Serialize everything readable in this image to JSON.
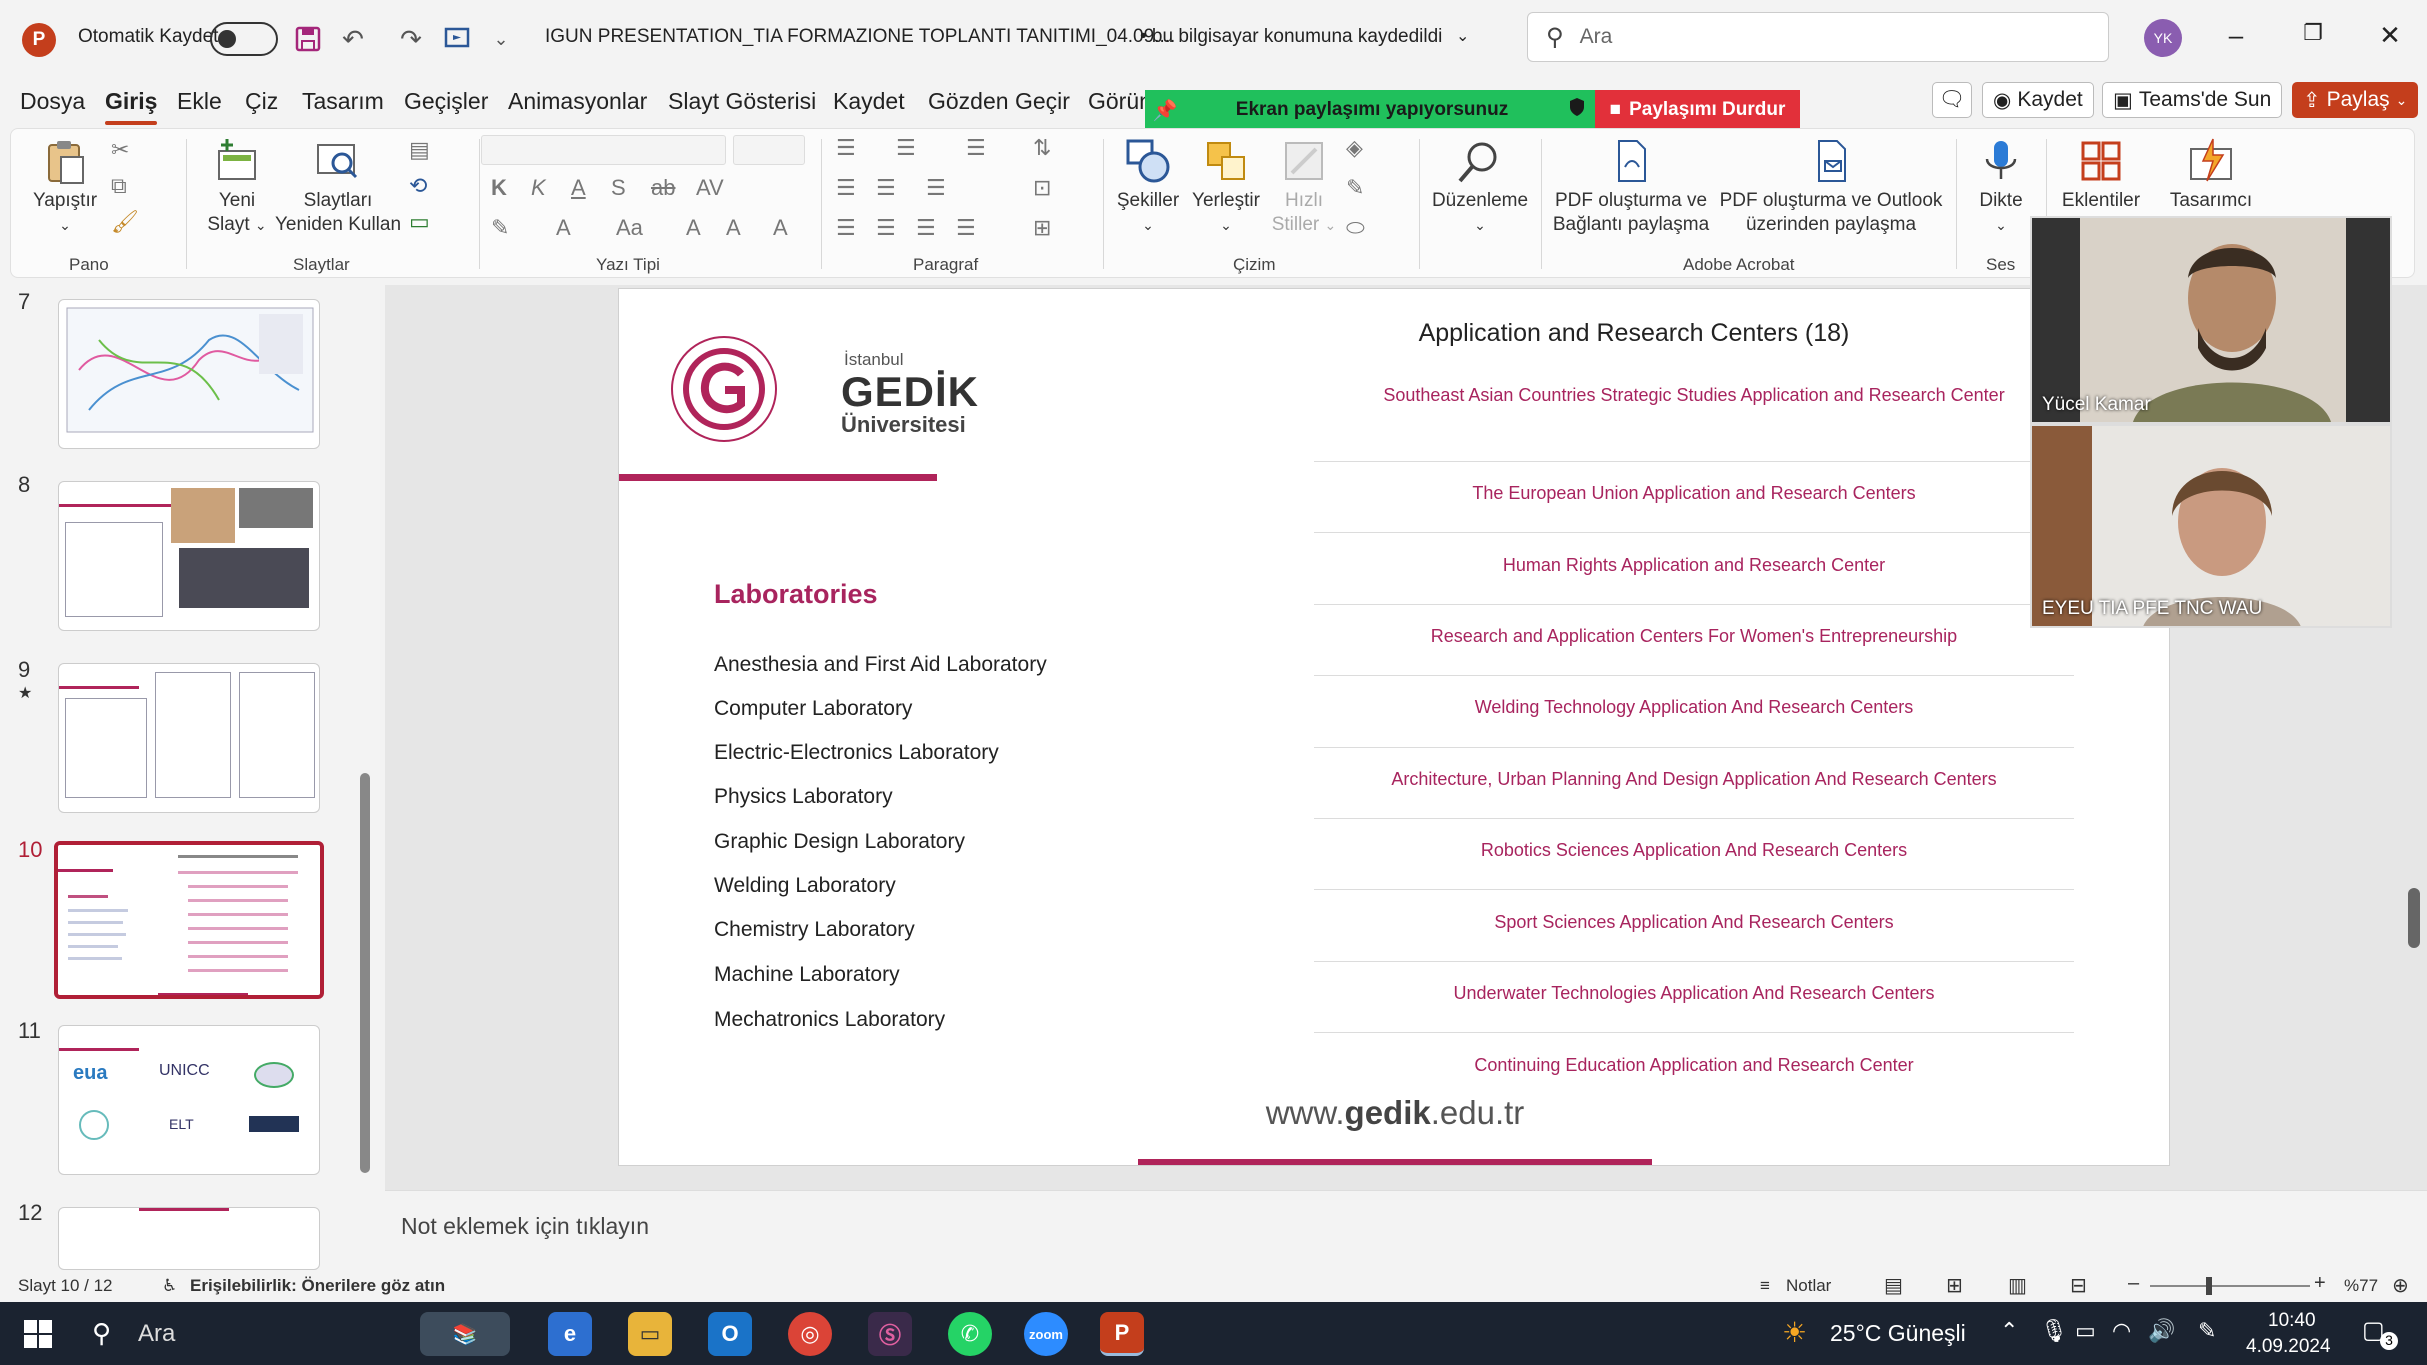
{
  "titlebar": {
    "app_icon": "P",
    "autosave_label": "Otomatik Kaydet",
    "file_name": "IGUN PRESENTATION_TIA FORMAZIONE TOPLANTI TANITIMI_04.09....",
    "save_status": "• bu bilgisayar konumuna kaydedildi",
    "search_placeholder": "Ara",
    "avatar_initials": "YK"
  },
  "menu": {
    "tabs": [
      "Dosya",
      "Giriş",
      "Ekle",
      "Çiz",
      "Tasarım",
      "Geçişler",
      "Animasyonlar",
      "Slayt Gösterisi",
      "Kaydet",
      "Gözden Geçir",
      "Görün"
    ],
    "sharing_bar": "Ekran paylaşımı yapıyorsunuz",
    "stop_sharing": "Paylaşımı Durdur",
    "kaydet_btn": "Kaydet",
    "teams_btn": "Teams'de Sun",
    "share_btn": "Paylaş"
  },
  "ribbon": {
    "paste": "Yapıştır",
    "new_slide_1": "Yeni",
    "new_slide_2": "Slayt",
    "reuse_1": "Slaytları",
    "reuse_2": "Yeniden Kullan",
    "shapes": "Şekiller",
    "arrange": "Yerleştir",
    "quick_1": "Hızlı",
    "quick_2": "Stiller",
    "editing": "Düzenleme",
    "pdf1_1": "PDF oluşturma ve",
    "pdf1_2": "Bağlantı paylaşma",
    "pdf2_1": "PDF oluşturma ve Outlook",
    "pdf2_2": "üzerinden paylaşma",
    "dictate": "Dikte",
    "addins": "Eklentiler",
    "designer": "Tasarımcı",
    "groups": {
      "pano": "Pano",
      "slaytlar": "Slaytlar",
      "yazi": "Yazı Tipi",
      "paragraf": "Paragraf",
      "cizim": "Çizim",
      "adobe": "Adobe Acrobat",
      "ses": "Ses"
    }
  },
  "thumbnails": [
    {
      "num": "7"
    },
    {
      "num": "8"
    },
    {
      "num": "9",
      "star": "★"
    },
    {
      "num": "10"
    },
    {
      "num": "11"
    },
    {
      "num": "12"
    }
  ],
  "slide": {
    "logo_line1": "İstanbul",
    "logo_line2": "GEDİK",
    "logo_line3": "Üniversitesi",
    "labs_title": "Laboratories",
    "labs": [
      "Anesthesia and First Aid Laboratory",
      "Computer Laboratory",
      "Electric-Electronics Laboratory",
      "Physics Laboratory",
      "Graphic Design Laboratory",
      "Welding Laboratory",
      "Chemistry Laboratory",
      "Machine Laboratory",
      "Mechatronics Laboratory"
    ],
    "rc_title": "Application and Research Centers (18)",
    "research_centers": [
      "Southeast Asian Countries Strategic Studies Application and Research Center",
      "The European Union Application and Research Centers",
      "Human Rights Application and Research Center",
      "Research and Application Centers For Women's Entrepreneurship",
      "Welding Technology Application And Research Centers",
      "Architecture, Urban Planning And Design Application And Research Centers",
      "Robotics Sciences Application And Research Centers",
      "Sport Sciences Application And Research Centers",
      "Underwater Technologies Application And Research Centers",
      "Continuing Education Application and Research Center"
    ],
    "website_pre": "www.",
    "website_bold": "gedik",
    "website_post": ".edu.tr"
  },
  "video": {
    "participant1": "Yücel Kamar",
    "participant2": "EYEU TIA PFE TNC WAU"
  },
  "notes_placeholder": "Not eklemek için tıklayın",
  "status": {
    "slide_count": "Slayt 10 / 12",
    "accessibility": "Erişilebilirlik: Önerilere göz atın",
    "notes": "Notlar",
    "zoom": "%77"
  },
  "taskbar": {
    "search": "Ara",
    "weather": "25°C  Güneşli",
    "time": "10:40",
    "date": "4.09.2024",
    "notif": "3"
  }
}
